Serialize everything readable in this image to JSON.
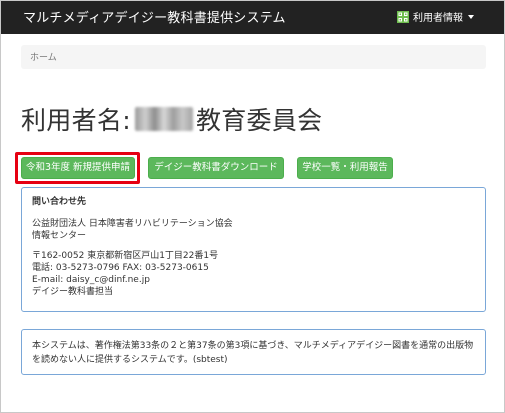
{
  "navbar": {
    "brand": "マルチメディアデイジー教科書提供システム",
    "user_menu_label": "利用者情報",
    "user_icon": "user-info-icon"
  },
  "breadcrumb": {
    "home": "ホーム"
  },
  "title": {
    "prefix": "利用者名:",
    "suffix": "教育委員会"
  },
  "actions": {
    "new_request": "令和3年度 新規提供申請",
    "download": "デイジー教科書ダウンロード",
    "school_list": "学校一覧・利用報告"
  },
  "contact": {
    "heading": "問い合わせ先",
    "org_line1": "公益財団法人 日本障害者リハビリテーション協会",
    "org_line2": "情報センター",
    "address": "〒162-0052 東京都新宿区戸山1丁目22番1号",
    "phone_fax": "電話: 03-5273-0796 FAX: 03-5273-0615",
    "email": "E-mail: daisy_c@dinf.ne.jp",
    "person": "デイジー教科書担当"
  },
  "notice": {
    "text": "本システムは、著作権法第33条の２と第37条の第3項に基づき、マルチメディアデイジー図書を通常の出版物を読めない人に提供するシステムです。(sbtest)"
  },
  "colors": {
    "navbar": "#222222",
    "button_green": "#5cb85c",
    "highlight_red": "#e60012",
    "panel_border": "#7aa7d8"
  }
}
